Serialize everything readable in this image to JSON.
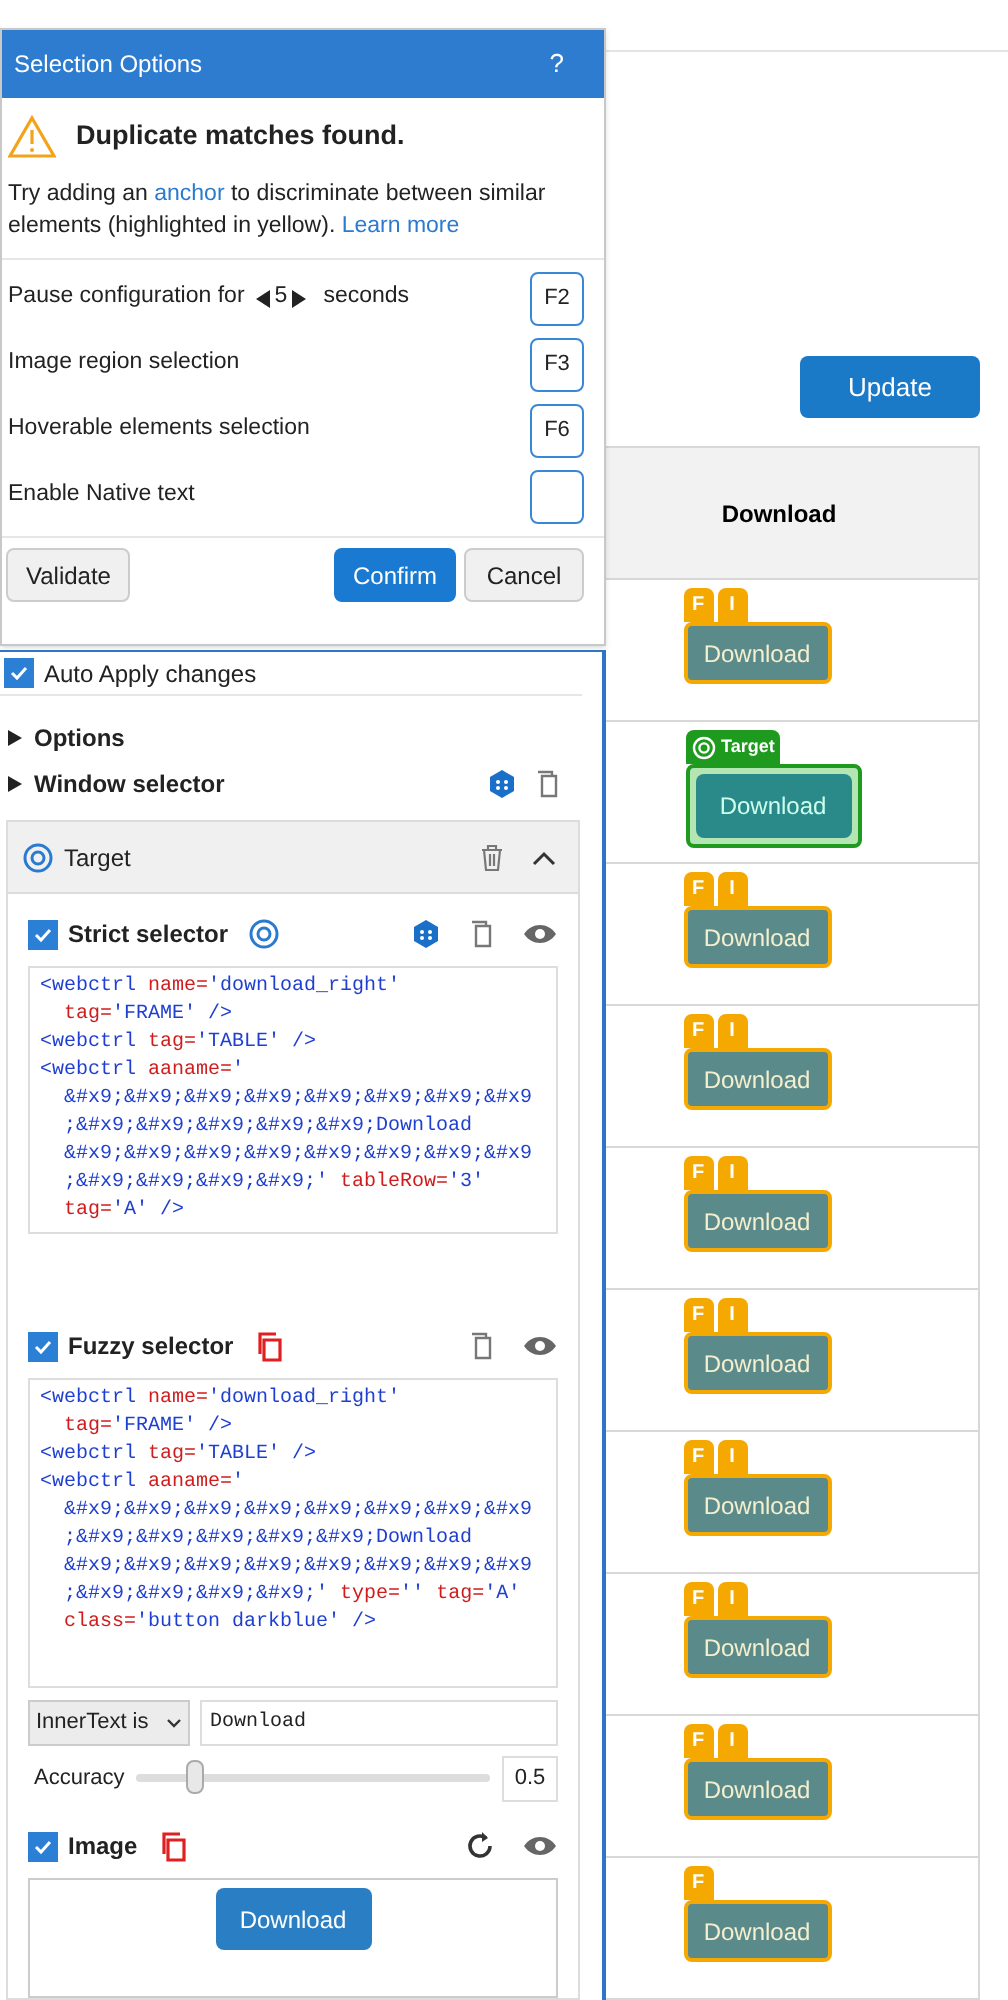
{
  "dialog": {
    "title": "Selection Options",
    "help": "?",
    "heading": "Duplicate matches found.",
    "message": [
      {
        "kind": "text",
        "text": "Try adding an"
      },
      {
        "kind": "link",
        "text": "anchor"
      },
      {
        "kind": "text",
        "text": "to discriminate between similar elements (highlighted in yellow)."
      },
      {
        "kind": "link",
        "text": "Learn more"
      }
    ],
    "options": [
      {
        "kind": "pause",
        "label": "Pause configuration for",
        "value": "5",
        "unit": "seconds",
        "hotkey": "F2"
      },
      {
        "kind": "plain",
        "label": "Image region selection",
        "hotkey": "F3"
      },
      {
        "kind": "plain",
        "label": "Hoverable elements selection",
        "hotkey": "F6"
      },
      {
        "kind": "plain",
        "label": "Enable Native text"
      }
    ],
    "buttons": [
      {
        "label": "Validate",
        "kind": "secondary"
      },
      {
        "label": "Confirm",
        "kind": "primary"
      },
      {
        "label": "Cancel",
        "kind": "secondary"
      }
    ]
  },
  "panel": {
    "auto_apply": {
      "label": "Auto Apply changes",
      "checked": true
    },
    "sections": [
      {
        "label": "Options",
        "expanded": false
      },
      {
        "label": "Window selector",
        "expanded": false
      }
    ],
    "target": {
      "title": "Target",
      "strict": {
        "label": "Strict selector",
        "checked": true,
        "code": [
          [
            {
              "kind": "tag",
              "text": "<webctrl "
            },
            {
              "kind": "attr",
              "text": "name="
            },
            {
              "kind": "value",
              "text": "'download_right'"
            }
          ],
          [
            {
              "kind": "attr",
              "text": "  tag="
            },
            {
              "kind": "value",
              "text": "'FRAME' />"
            }
          ],
          [
            {
              "kind": "tag",
              "text": "<webctrl "
            },
            {
              "kind": "attr",
              "text": "tag="
            },
            {
              "kind": "value",
              "text": "'TABLE' />"
            }
          ],
          [
            {
              "kind": "tag",
              "text": "<webctrl "
            },
            {
              "kind": "attr",
              "text": "aaname="
            },
            {
              "kind": "value",
              "text": "'"
            }
          ],
          [
            {
              "kind": "value",
              "text": "  &#x9;&#x9;&#x9;&#x9;&#x9;&#x9;&#x9;&#x9"
            }
          ],
          [
            {
              "kind": "value",
              "text": "  ;&#x9;&#x9;&#x9;&#x9;&#x9;Download"
            }
          ],
          [
            {
              "kind": "value",
              "text": "  &#x9;&#x9;&#x9;&#x9;&#x9;&#x9;&#x9;&#x9"
            }
          ],
          [
            {
              "kind": "value",
              "text": "  ;&#x9;&#x9;&#x9;&#x9;' "
            },
            {
              "kind": "attr",
              "text": "tableRow="
            },
            {
              "kind": "value",
              "text": "'3'"
            }
          ],
          [
            {
              "kind": "attr",
              "text": "  tag="
            },
            {
              "kind": "value",
              "text": "'A' />"
            }
          ]
        ]
      },
      "fuzzy": {
        "label": "Fuzzy selector",
        "checked": true,
        "code": [
          [
            {
              "kind": "tag",
              "text": "<webctrl "
            },
            {
              "kind": "attr",
              "text": "name="
            },
            {
              "kind": "value",
              "text": "'download_right'"
            }
          ],
          [
            {
              "kind": "attr",
              "text": "  tag="
            },
            {
              "kind": "value",
              "text": "'FRAME' />"
            }
          ],
          [
            {
              "kind": "tag",
              "text": "<webctrl "
            },
            {
              "kind": "attr",
              "text": "tag="
            },
            {
              "kind": "value",
              "text": "'TABLE' />"
            }
          ],
          [
            {
              "kind": "tag",
              "text": "<webctrl "
            },
            {
              "kind": "attr",
              "text": "aaname="
            },
            {
              "kind": "value",
              "text": "'"
            }
          ],
          [
            {
              "kind": "value",
              "text": "  &#x9;&#x9;&#x9;&#x9;&#x9;&#x9;&#x9;&#x9"
            }
          ],
          [
            {
              "kind": "value",
              "text": "  ;&#x9;&#x9;&#x9;&#x9;&#x9;Download"
            }
          ],
          [
            {
              "kind": "value",
              "text": "  &#x9;&#x9;&#x9;&#x9;&#x9;&#x9;&#x9;&#x9"
            }
          ],
          [
            {
              "kind": "value",
              "text": "  ;&#x9;&#x9;&#x9;&#x9;' "
            },
            {
              "kind": "attr",
              "text": "type="
            },
            {
              "kind": "value",
              "text": "'' "
            },
            {
              "kind": "attr",
              "text": "tag="
            },
            {
              "kind": "value",
              "text": "'A'"
            }
          ],
          [
            {
              "kind": "attr",
              "text": "  class="
            },
            {
              "kind": "value",
              "text": "'button darkblue' />"
            }
          ]
        ],
        "property": "InnerText is",
        "property_value": "Download",
        "accuracy_label": "Accuracy",
        "accuracy": {
          "level": 0.16,
          "reading": "0.5"
        }
      },
      "image": {
        "label": "Image",
        "checked": true,
        "preview": "Download"
      }
    }
  },
  "page": {
    "update": "Update",
    "column": "Download",
    "rows": [
      {
        "kind": "match",
        "badges": [
          "F",
          "I"
        ],
        "button": "Download"
      },
      {
        "kind": "target",
        "badges": [
          "Target"
        ],
        "button": "Download"
      },
      {
        "kind": "match",
        "badges": [
          "F",
          "I"
        ],
        "button": "Download"
      },
      {
        "kind": "match",
        "badges": [
          "F",
          "I"
        ],
        "button": "Download"
      },
      {
        "kind": "match",
        "badges": [
          "F",
          "I"
        ],
        "button": "Download"
      },
      {
        "kind": "match",
        "badges": [
          "F",
          "I"
        ],
        "button": "Download"
      },
      {
        "kind": "match",
        "badges": [
          "F",
          "I"
        ],
        "button": "Download"
      },
      {
        "kind": "match",
        "badges": [
          "F",
          "I"
        ],
        "button": "Download"
      },
      {
        "kind": "match",
        "badges": [
          "F",
          "I"
        ],
        "button": "Download"
      },
      {
        "kind": "match",
        "badges": [
          "F"
        ],
        "button": "Download"
      }
    ]
  }
}
